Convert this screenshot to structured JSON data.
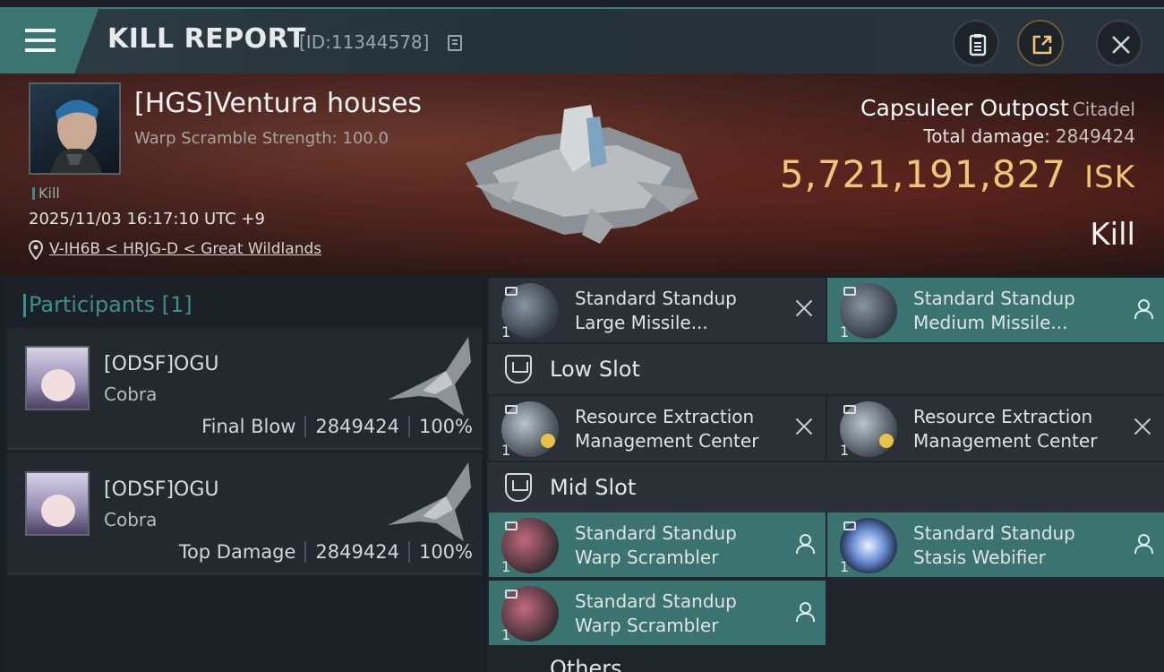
{
  "header": {
    "title": "KILL REPORT",
    "km_id": "[ID:11344578]"
  },
  "victim": {
    "name": "[HGS]Ventura houses",
    "warp_scramble": "Warp Scramble Strength: 100.0",
    "outcome_tag": "Kill",
    "datetime": "2025/11/03 16:17:10 UTC +9",
    "location": "V-IH6B < HRJG-D < Great Wildlands"
  },
  "target": {
    "name": "Capsuleer Outpost",
    "type": "Citadel",
    "damage_label": "Total damage:",
    "damage_value": "2849424",
    "isk_value": "5,721,191,827",
    "isk_unit": "ISK",
    "outcome": "Kill"
  },
  "participants": {
    "heading": "Participants",
    "count": "[1]",
    "items": [
      {
        "name": "[ODSF]OGU",
        "ship": "Cobra",
        "role": "Final Blow",
        "damage": "2849424",
        "percent": "100%"
      },
      {
        "name": "[ODSF]OGU",
        "ship": "Cobra",
        "role": "Top Damage",
        "damage": "2849424",
        "percent": "100%"
      }
    ]
  },
  "modules": {
    "top": [
      {
        "line1": "Standard Standup",
        "line2": "Large Missile...",
        "count": "1",
        "status": "destroyed"
      },
      {
        "line1": "Standard Standup",
        "line2": "Medium Missile...",
        "count": "1",
        "status": "dropped"
      }
    ],
    "low_slot_label": "Low Slot",
    "low": [
      {
        "line1": "Resource Extraction",
        "line2": "Management Center",
        "count": "1",
        "status": "destroyed"
      },
      {
        "line1": "Resource Extraction",
        "line2": "Management Center",
        "count": "1",
        "status": "destroyed"
      }
    ],
    "mid_slot_label": "Mid Slot",
    "mid": [
      {
        "line1": "Standard Standup",
        "line2": "Warp Scrambler",
        "count": "1",
        "status": "dropped"
      },
      {
        "line1": "Standard Standup",
        "line2": "Stasis Webifier",
        "count": "1",
        "status": "dropped"
      },
      {
        "line1": "Standard Standup",
        "line2": "Warp Scrambler",
        "count": "1",
        "status": "dropped"
      }
    ],
    "others_label": "Others"
  },
  "icons": {
    "menu": "hamburger-icon",
    "copy": "copy-icon",
    "clipboard": "clipboard-icon",
    "share": "share-icon",
    "close": "close-icon",
    "location": "location-pin-icon"
  },
  "colors": {
    "accent_teal": "#3a736f",
    "isk_gold": "#f0c577"
  }
}
